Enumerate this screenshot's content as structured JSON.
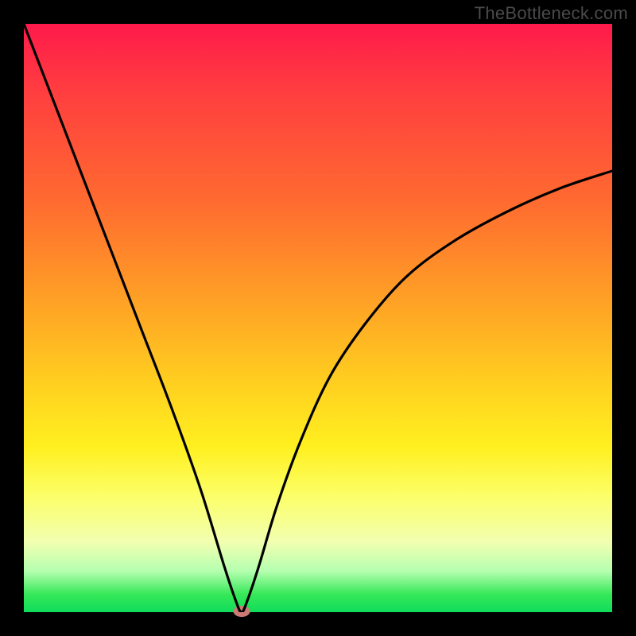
{
  "watermark": "TheBottleneck.com",
  "colors": {
    "frame": "#000000",
    "curve": "#000000",
    "marker": "#cc7b74",
    "gradient_stops": [
      "#ff1a4b",
      "#ff3f3f",
      "#ff6a30",
      "#ffa425",
      "#ffd21f",
      "#fff020",
      "#fcff66",
      "#f2ffb0",
      "#b6ffb0",
      "#36e858",
      "#0fdc5a"
    ]
  },
  "chart_data": {
    "type": "line",
    "title": "",
    "xlabel": "",
    "ylabel": "",
    "xlim": [
      0,
      100
    ],
    "ylim": [
      0,
      100
    ],
    "grid": false,
    "legend": false,
    "note": "Axes are unlabeled; x and y read as percent of plot width/height. y=0 at bottom (green), y=100 at top (red). Curve dips to ~0 at x≈37 then rises.",
    "series": [
      {
        "name": "bottleneck-curve",
        "x": [
          0,
          5,
          10,
          15,
          20,
          25,
          30,
          34,
          36,
          37,
          38,
          40,
          43,
          47,
          52,
          58,
          65,
          73,
          82,
          91,
          100
        ],
        "y": [
          100,
          87,
          74,
          61,
          48,
          35,
          21,
          8,
          2,
          0,
          2,
          8,
          18,
          29,
          40,
          49,
          57,
          63,
          68,
          72,
          75
        ]
      }
    ],
    "marker": {
      "x": 37,
      "y": 0.2,
      "shape": "ellipse",
      "color": "#cc7b74"
    }
  }
}
